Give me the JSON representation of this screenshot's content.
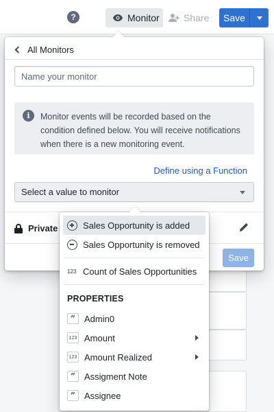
{
  "toolbar": {
    "help_label": "?",
    "monitor_label": "Monitor",
    "share_label": "Share",
    "save_label": "Save"
  },
  "panel": {
    "back_label": "All Monitors",
    "name_placeholder": "Name your monitor",
    "info_text": "Monitor events will be recorded based on the condition defined below. You will receive notifications when there is a new monitoring event.",
    "function_link": "Define using a Function",
    "select_placeholder": "Select a value to monitor",
    "visibility_label": "Private",
    "save_label": "Save"
  },
  "menu": {
    "events": [
      {
        "icon": "plus-circle-icon",
        "label": "Sales Opportunity is added"
      },
      {
        "icon": "minus-circle-icon",
        "label": "Sales Opportunity is removed"
      }
    ],
    "count": {
      "icon_text": "123",
      "label": "Count of Sales Opportunities"
    },
    "properties_header": "PROPERTIES",
    "properties": [
      {
        "type": "string",
        "icon_text": "”",
        "label": "Admin0",
        "has_submenu": false
      },
      {
        "type": "number",
        "icon_text": "123",
        "label": "Amount",
        "has_submenu": true
      },
      {
        "type": "number",
        "icon_text": "123",
        "label": "Amount Realized",
        "has_submenu": true
      },
      {
        "type": "string",
        "icon_text": "”",
        "label": "Assigment Note",
        "has_submenu": false
      },
      {
        "type": "string",
        "icon_text": "”",
        "label": "Assignee",
        "has_submenu": false
      }
    ]
  },
  "colors": {
    "primary": "#2d72d2",
    "primary_disabled": "#8eb3e8",
    "link": "#215db0",
    "callout_bg": "#eceef1",
    "hover_bg": "#e5e8eb"
  }
}
